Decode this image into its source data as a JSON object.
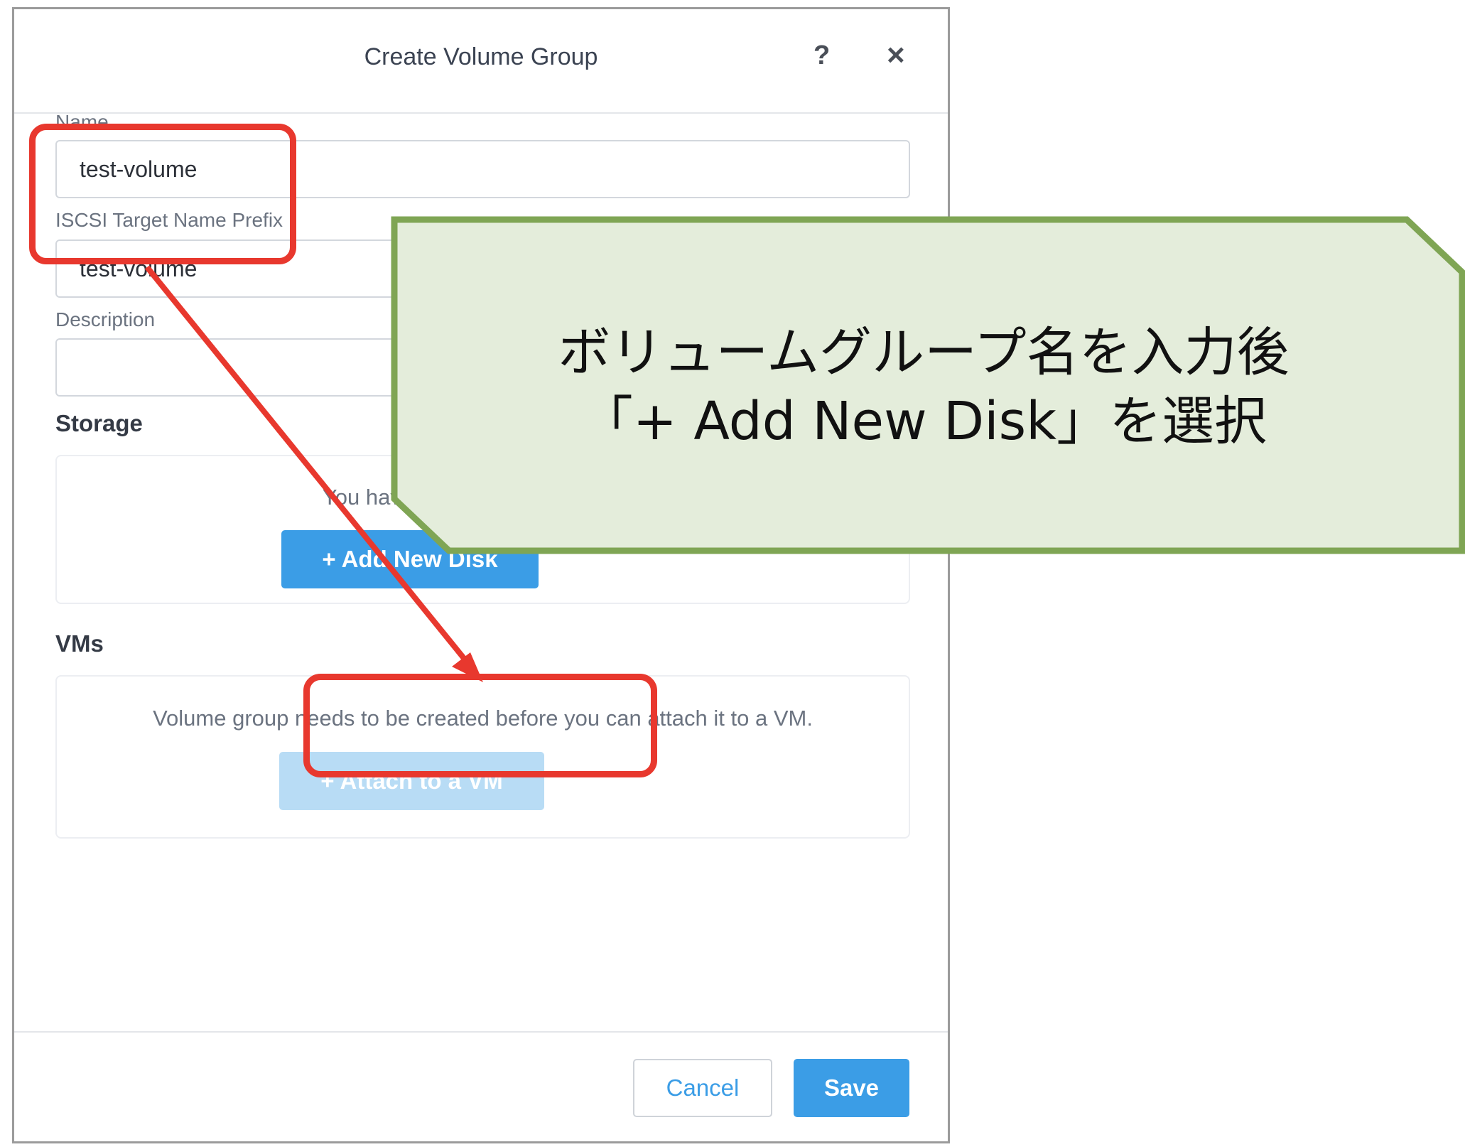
{
  "dialog": {
    "title": "Create Volume Group",
    "help_glyph": "?",
    "close_glyph": "×"
  },
  "fields": {
    "name_label": "Name",
    "name_value": "test-volume",
    "iscsi_label": "ISCSI Target Name Prefix",
    "iscsi_value": "test-volume",
    "description_label": "Description",
    "description_value": ""
  },
  "storage": {
    "title": "Storage",
    "empty_text": "You haven't added any disks yet.",
    "add_disk_label": "+   Add New Disk"
  },
  "vms": {
    "title": "VMs",
    "empty_text": "Volume group needs to be created before you can attach it to a VM.",
    "attach_label": "+   Attach to a VM"
  },
  "footer": {
    "cancel_label": "Cancel",
    "save_label": "Save"
  },
  "annotation": {
    "line1": "ボリュームグループ名を入力後",
    "line2": "「+ Add New Disk」を選択",
    "fill_color": "#e4eddb",
    "border_color": "#7fa554",
    "highlight_color": "#e8382e"
  },
  "colors": {
    "accent": "#3b9de6"
  }
}
